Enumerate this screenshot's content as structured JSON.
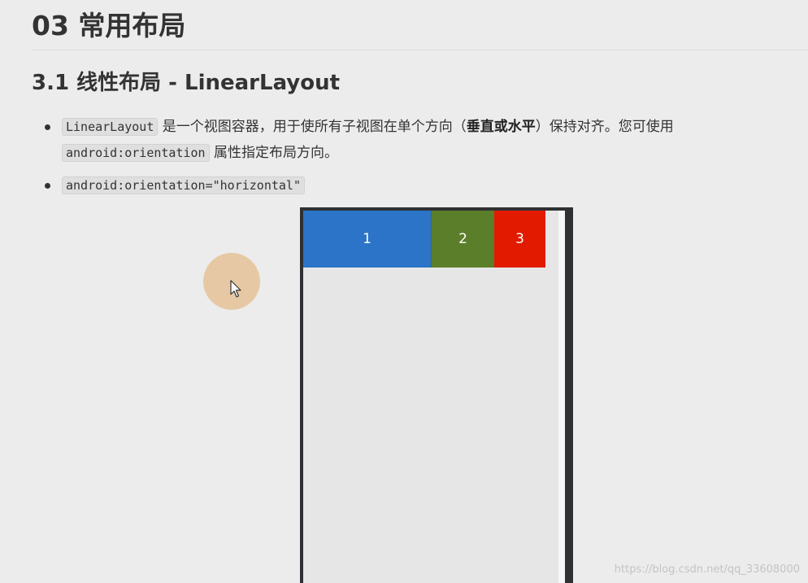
{
  "heading": {
    "title": "03 常用布局"
  },
  "section": {
    "title": "3.1 线性布局 - LinearLayout"
  },
  "bullets": [
    {
      "code1": "LinearLayout",
      "text1": " 是一个视图容器，用于使所有子视图在单个方向（",
      "bold": "垂直或水平",
      "text2": "）保持对齐。您可使用",
      "code2": "android:orientation",
      "text3": " 属性指定布局方向。"
    },
    {
      "code": "android:orientation=\"horizontal\""
    }
  ],
  "phone": {
    "boxes": [
      {
        "label": "1",
        "color": "#2b74c7"
      },
      {
        "label": "2",
        "color": "#5b7e2a"
      },
      {
        "label": "3",
        "color": "#e21a00"
      }
    ],
    "screen_color": "#e6e6e6",
    "frame_color": "#2f3033"
  },
  "cursor": {
    "icon": "mouse-pointer-icon",
    "halo_color": "#e6c9a4"
  },
  "watermark": {
    "text": "https://blog.csdn.net/qq_33608000"
  }
}
